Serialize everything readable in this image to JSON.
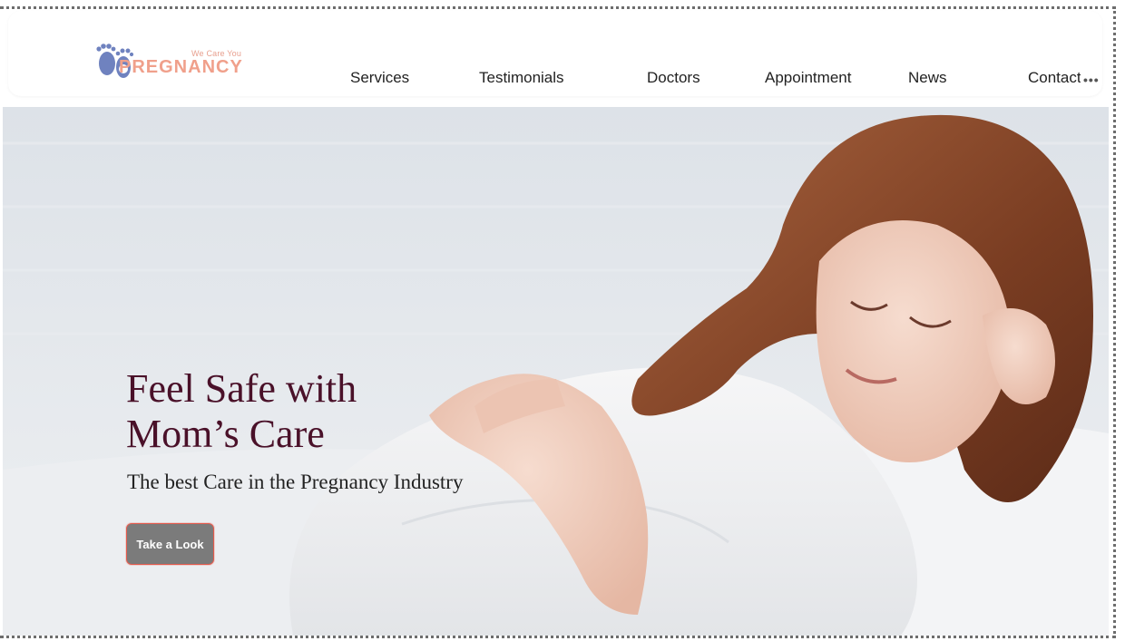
{
  "brand": {
    "tagline": "We Care You",
    "wordmark": "PREGNANCY",
    "colors": {
      "feet": "#6f82bf",
      "wordmark": "#f0a08b"
    }
  },
  "nav": {
    "items": [
      {
        "label": "Services"
      },
      {
        "label": "Testimonials"
      },
      {
        "label": "Doctors"
      },
      {
        "label": "Appointment"
      },
      {
        "label": "News"
      },
      {
        "label": "Contact"
      }
    ],
    "more_label": "•••"
  },
  "hero": {
    "title_line1": "Feel Safe with",
    "title_line2": "Mom’s Care",
    "subtitle": "The best Care in the Pregnancy Industry",
    "cta_label": "Take a Look",
    "colors": {
      "title": "#4a1129",
      "cta_bg": "#7b7b7b",
      "cta_border": "#e35a4d"
    }
  }
}
